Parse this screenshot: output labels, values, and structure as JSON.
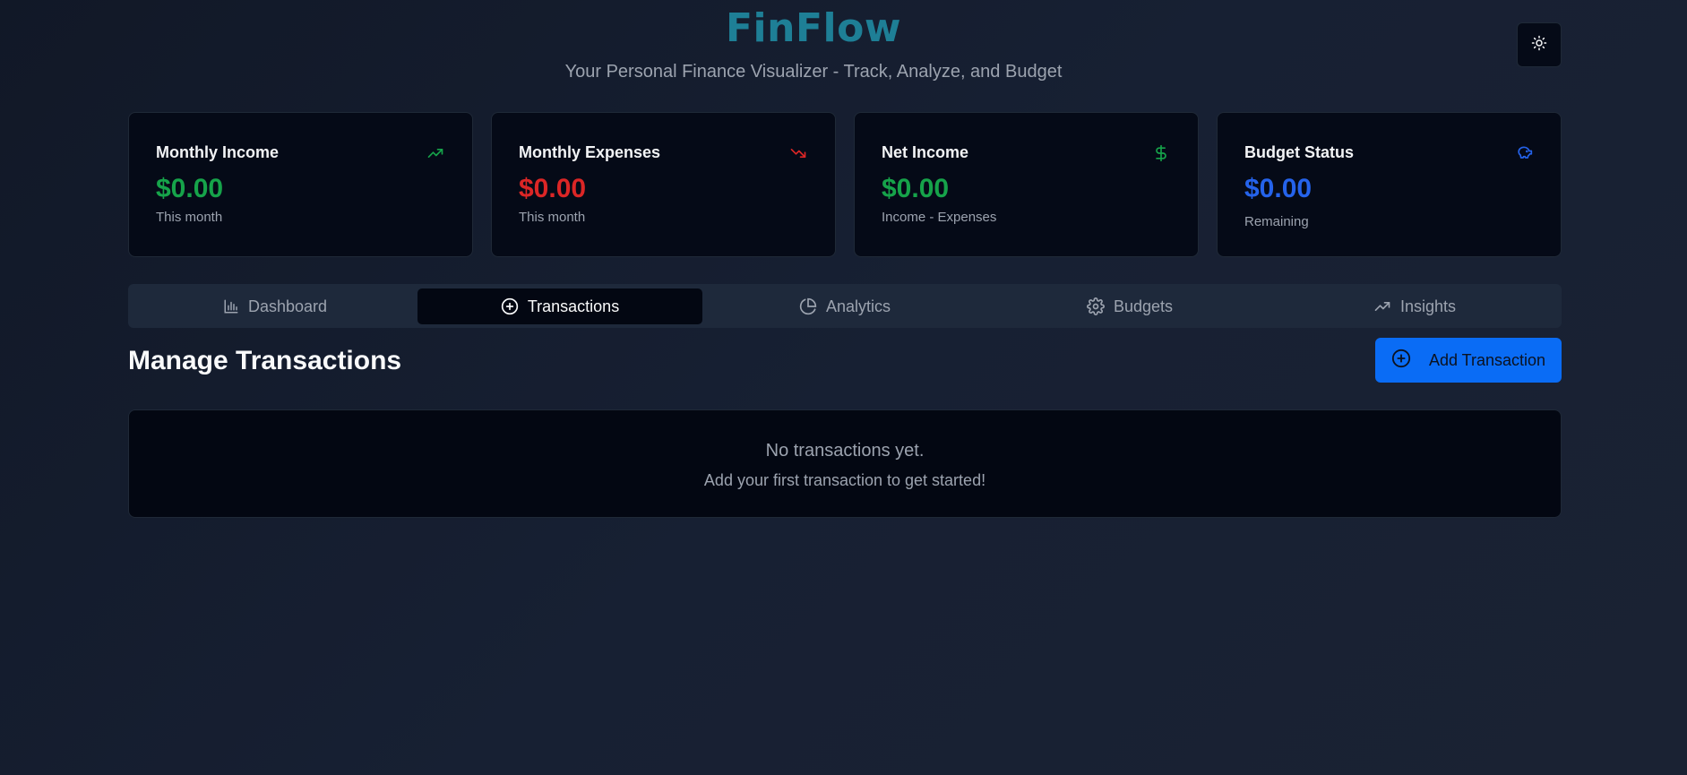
{
  "header": {
    "brand": "FinFlow",
    "tagline": "Your Personal Finance Visualizer - Track, Analyze, and Budget",
    "theme_toggle_icon": "sun-icon"
  },
  "cards": [
    {
      "title": "Monthly Income",
      "value": "$0.00",
      "subtitle": "This month",
      "icon": "trending-up-icon",
      "color": "#16a34a"
    },
    {
      "title": "Monthly Expenses",
      "value": "$0.00",
      "subtitle": "This month",
      "icon": "trending-down-icon",
      "color": "#dc2626"
    },
    {
      "title": "Net Income",
      "value": "$0.00",
      "subtitle": "Income - Expenses",
      "icon": "dollar-icon",
      "color": "#16a34a"
    },
    {
      "title": "Budget Status",
      "value": "$0.00",
      "subtitle": "Remaining",
      "icon": "piggy-bank-icon",
      "color": "#2563eb"
    }
  ],
  "tabs": [
    {
      "label": "Dashboard",
      "icon": "bar-chart-icon",
      "active": false
    },
    {
      "label": "Transactions",
      "icon": "plus-circle-icon",
      "active": true
    },
    {
      "label": "Analytics",
      "icon": "pie-chart-icon",
      "active": false
    },
    {
      "label": "Budgets",
      "icon": "gear-icon",
      "active": false
    },
    {
      "label": "Insights",
      "icon": "trending-up-icon",
      "active": false
    }
  ],
  "main": {
    "title": "Manage Transactions",
    "add_button_label": "Add Transaction",
    "add_button_icon": "plus-circle-icon",
    "empty_title": "No transactions yet.",
    "empty_subtitle": "Add your first transaction to get started!"
  },
  "colors": {
    "brand": "#1e7f96",
    "accent": "#0a6cf5",
    "income": "#16a34a",
    "expense": "#dc2626",
    "budget": "#2563eb"
  }
}
